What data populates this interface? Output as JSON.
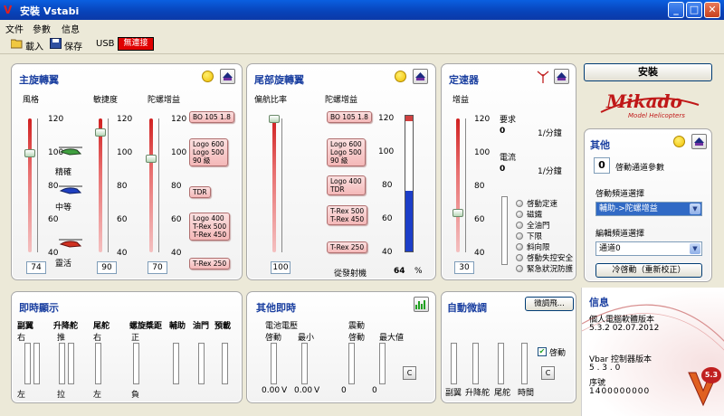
{
  "window": {
    "title": "安裝 Vstabi",
    "min": "_",
    "max": "□",
    "close": "✕"
  },
  "menu": [
    "文件",
    "參數",
    "信息"
  ],
  "toolbar": {
    "load": "載入",
    "save": "保存",
    "usb": "USB",
    "status": "無連接"
  },
  "colors": {
    "accent": "#1a3fa0",
    "offline": "#e00000",
    "pitch_fill": "#1c3ec8"
  },
  "main_rotor": {
    "title": "主旋轉翼",
    "style_label": "風格",
    "agility_label": "敏捷度",
    "gyro_label": "陀螺增益",
    "scale": [
      "120",
      "100",
      "80",
      "60",
      "40"
    ],
    "style_levels": [
      "精確",
      "中等",
      "靈活"
    ],
    "style_value": "74",
    "agility_value": "90",
    "gyro_value": "70",
    "style_pos": 0.74,
    "agility_pos": 0.9,
    "gyro_pos": 0.7,
    "presets": [
      "BO 105 1.8",
      "Logo 600\nLogo 500\n90 級",
      "TDR",
      "Logo 400\nT-Rex 500\nT-Rex 450",
      "T-Rex 250"
    ]
  },
  "tail_rotor": {
    "title": "尾部旋轉翼",
    "compensation_label": "偏航比率",
    "gyro_label": "陀螺增益",
    "scale": [
      "120",
      "100",
      "80",
      "60",
      "40"
    ],
    "compensation_value": "100",
    "compensation_pos": 1.0,
    "presets": [
      "BO 105 1.8",
      "Logo 600\nLogo 500\n90 級",
      "Logo 400\nTDR",
      "T-Rex 500\nT-Rex 450",
      "T-Rex 250"
    ],
    "pitch_label": "從發射機",
    "pitch_value": "64",
    "pitch_unit": "%",
    "pitch_fraction": 0.45
  },
  "governor": {
    "title": "定速器",
    "gain_label": "增益",
    "scale": [
      "120",
      "100",
      "80",
      "60",
      "40"
    ],
    "gain_value": "30",
    "gain_pos": 0.3,
    "request_label": "要求",
    "request_value": "0",
    "request_unit": "1/分鐘",
    "current_label": "電流",
    "current_value": "0",
    "current_unit": "1/分鐘",
    "status_items": [
      "啓動定速",
      "磁鐵",
      "全油門",
      "下限",
      "斜向限",
      "啓動失控安全",
      "緊急狀況防護"
    ]
  },
  "install_button": "安裝",
  "logo": {
    "name": "Mikado",
    "tagline": "Model Helicopters"
  },
  "other": {
    "title": "其他",
    "channel_count": "0",
    "channel_label": "啓動通道參數",
    "start_mode_label": "啓動頻道選擇",
    "start_mode_value": "輔助->陀螺增益",
    "edit_channel_label": "編輯頻道選擇",
    "edit_channel_value": "通道0",
    "reset_button": "冷啓動（重新校正）"
  },
  "realtime": {
    "title": "即時顯示",
    "columns": [
      "副翼",
      "升降舵",
      "尾舵",
      "螺旋槳距",
      "輔助",
      "油門",
      "預載"
    ],
    "top": [
      "右",
      "推",
      "右",
      "正",
      "",
      "",
      ""
    ],
    "bottom": [
      "左",
      "拉",
      "左",
      "負",
      "",
      "",
      ""
    ]
  },
  "other_realtime": {
    "title": "其他即時",
    "battery_label": "電池電壓",
    "vibration_label": "震動",
    "start_label": "啓動",
    "min_label": "最小",
    "max_label": "最大値",
    "battery_start": "0.00",
    "battery_min": "0.00",
    "battery_unit": "V",
    "vib_start": "0",
    "vib_max": "0",
    "clear": "C"
  },
  "auto_trim": {
    "title": "自動微調",
    "fine_button": "微調飛...",
    "enable_label": "啓動",
    "enabled": true,
    "columns": [
      "副翼",
      "升降舵",
      "尾舵",
      "時間"
    ],
    "clear": "C"
  },
  "info": {
    "title": "信息",
    "pc_label": "個人電腦軟體版本",
    "pc_version": "5.3.2  02.07.2012",
    "vbar_label": "Vbar 控制器版本",
    "vbar_version": "5 . 3 . 0",
    "serial_label": "序號",
    "serial_value": "1400000000",
    "badge": "5.3"
  }
}
